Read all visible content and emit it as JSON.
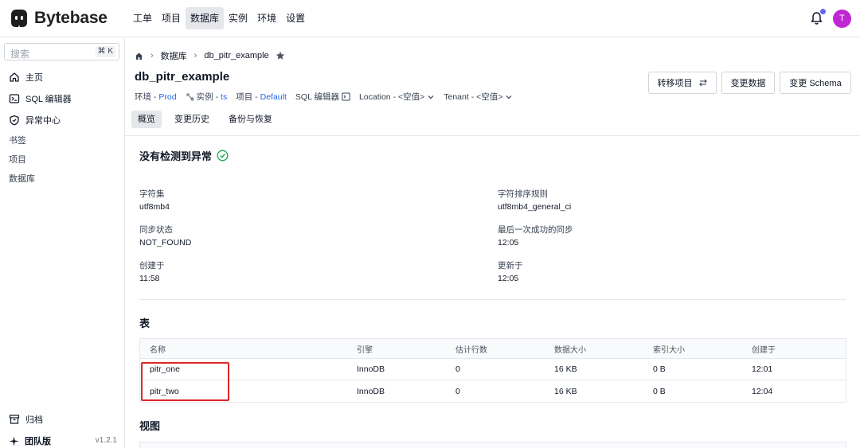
{
  "app": {
    "logo_text": "Bytebase"
  },
  "topnav": [
    {
      "label": "工单",
      "active": false
    },
    {
      "label": "项目",
      "active": false
    },
    {
      "label": "数据库",
      "active": true
    },
    {
      "label": "实例",
      "active": false
    },
    {
      "label": "环境",
      "active": false
    },
    {
      "label": "设置",
      "active": false
    }
  ],
  "user": {
    "avatar_initial": "T"
  },
  "sidebar": {
    "search_placeholder": "搜索",
    "search_shortcut": "⌘ K",
    "items": [
      {
        "label": "主页",
        "icon": "home-icon"
      },
      {
        "label": "SQL 编辑器",
        "icon": "terminal-icon"
      },
      {
        "label": "异常中心",
        "icon": "shield-icon"
      }
    ],
    "sections": [
      "书签",
      "项目",
      "数据库"
    ],
    "archive_label": "归档",
    "plan_label": "团队版",
    "version": "v1.2.1"
  },
  "breadcrumb": {
    "items": [
      "数据库",
      "db_pitr_example"
    ]
  },
  "database": {
    "name": "db_pitr_example",
    "meta": {
      "env_label": "环境 -",
      "env_value": "Prod",
      "instance_label": "实例 -",
      "instance_value": "ts",
      "project_label": "项目 -",
      "project_value": "Default",
      "sql_editor_label": "SQL 编辑器",
      "location_label": "Location - <空值>",
      "tenant_label": "Tenant - <空值>"
    }
  },
  "actions": {
    "transfer": "转移项目",
    "change_data": "变更数据",
    "change_schema": "变更 Schema"
  },
  "tabs": [
    {
      "label": "概览",
      "active": true
    },
    {
      "label": "变更历史",
      "active": false
    },
    {
      "label": "备份与恢复",
      "active": false
    }
  ],
  "anomaly": {
    "title": "没有检测到异常"
  },
  "info": [
    {
      "label": "字符集",
      "value": "utf8mb4"
    },
    {
      "label": "字符排序规则",
      "value": "utf8mb4_general_ci"
    },
    {
      "label": "同步状态",
      "value": "NOT_FOUND"
    },
    {
      "label": "最后一次成功的同步",
      "value": "12:05"
    },
    {
      "label": "创建于",
      "value": "11:58"
    },
    {
      "label": "更新于",
      "value": "12:05"
    }
  ],
  "tables_section": {
    "title": "表",
    "columns": [
      "名称",
      "引擎",
      "估计行数",
      "数据大小",
      "索引大小",
      "创建于"
    ],
    "rows": [
      [
        "pitr_one",
        "InnoDB",
        "0",
        "16 KB",
        "0 B",
        "12:01"
      ],
      [
        "pitr_two",
        "InnoDB",
        "0",
        "16 KB",
        "0 B",
        "12:04"
      ]
    ]
  },
  "views_section": {
    "title": "视图"
  },
  "colors": {
    "accent": "#2563eb",
    "highlight": "#dc2626",
    "success": "#16a34a",
    "avatar": "#c026d3"
  }
}
